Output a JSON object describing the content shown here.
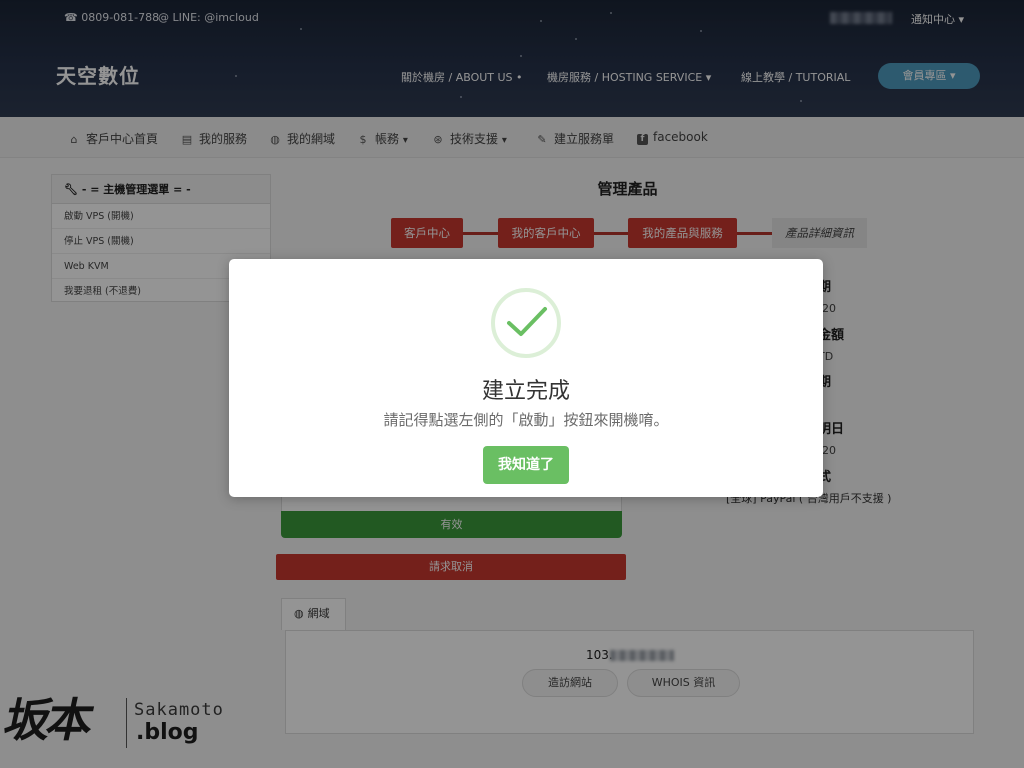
{
  "topbar": {
    "phone": "0809-081-788",
    "line": "LINE: @imcloud",
    "notify_label": "通知中心"
  },
  "brand": {
    "name": "天空數位"
  },
  "main_nav": {
    "items": [
      {
        "label": "關於機房 / ABOUT US"
      },
      {
        "label": "機房服務 / HOSTING SERVICE"
      },
      {
        "label": "線上教學 / TUTORIAL"
      }
    ],
    "member_button": "會員專區"
  },
  "sub_nav": {
    "items": [
      {
        "label": "客戶中心首頁",
        "icon": "home-icon"
      },
      {
        "label": "我的服務",
        "icon": "server-icon"
      },
      {
        "label": "我的網域",
        "icon": "globe-icon"
      },
      {
        "label": "帳務",
        "icon": "dollar-icon"
      },
      {
        "label": "技術支援",
        "icon": "lifebuoy-icon"
      },
      {
        "label": "建立服務單",
        "icon": "edit-icon"
      },
      {
        "label": "facebook",
        "icon": "facebook-icon"
      }
    ]
  },
  "sidebar": {
    "title": "- = 主機管理選單 = -",
    "items": [
      {
        "label": "啟動 VPS (開機)"
      },
      {
        "label": "停止 VPS (關機)"
      },
      {
        "label": "Web KVM"
      },
      {
        "label": "我要退租 (不退費)"
      }
    ]
  },
  "main": {
    "page_title": "管理產品",
    "breadcrumb": [
      {
        "label": "客戶中心"
      },
      {
        "label": "我的客戶中心"
      },
      {
        "label": "我的產品與服務"
      },
      {
        "label": "產品詳細資訊"
      }
    ],
    "status_label": "有效",
    "cancel_label": "請求取消",
    "right_fragments": {
      "r1": "期",
      "r2": "-20",
      "r3": "金額",
      "r4": "TD",
      "r5": "期",
      "r6": "明日",
      "r7": "-20",
      "r8": "式"
    },
    "payment_method": "[全球] PayPal ( 台灣用戶不支援 )",
    "domain_tab": "網域",
    "ip_prefix": "103.",
    "visit_button": "造訪網站",
    "whois_button": "WHOIS 資訊"
  },
  "modal": {
    "title": "建立完成",
    "message": "請記得點選左側的「啟動」按鈕來開機唷。",
    "confirm_label": "我知道了",
    "accent_color": "#6abf63"
  },
  "watermark": {
    "text_cn": "坂本",
    "text_en": "Sakamoto",
    "text_blog": ".blog"
  }
}
